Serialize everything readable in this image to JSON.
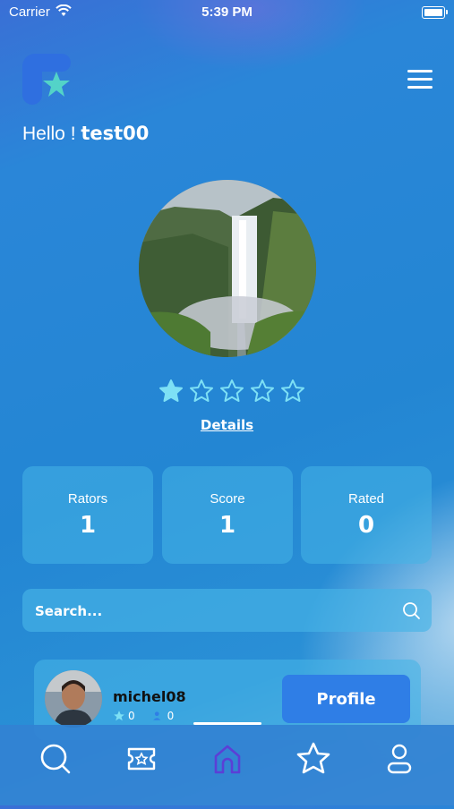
{
  "status_bar": {
    "carrier": "Carrier",
    "time": "5:39 PM"
  },
  "header": {
    "greeting": "Hello ! ",
    "username": "test00"
  },
  "rating": {
    "value": 1,
    "max": 5,
    "details_label": "Details"
  },
  "stats": [
    {
      "label": "Rators",
      "value": "1"
    },
    {
      "label": "Score",
      "value": "1"
    },
    {
      "label": "Rated",
      "value": "0"
    }
  ],
  "search": {
    "placeholder": "Search..."
  },
  "user_card": {
    "name": "michel08",
    "stars": "0",
    "count": "0",
    "button_label": "Profile"
  },
  "tabs": [
    "search-tab",
    "ticket-tab",
    "home-tab",
    "favorites-tab",
    "profile-tab"
  ],
  "colors": {
    "accent": "#2f7ee6",
    "star": "#7de0f5",
    "active_tab": "#5b3fd6"
  }
}
